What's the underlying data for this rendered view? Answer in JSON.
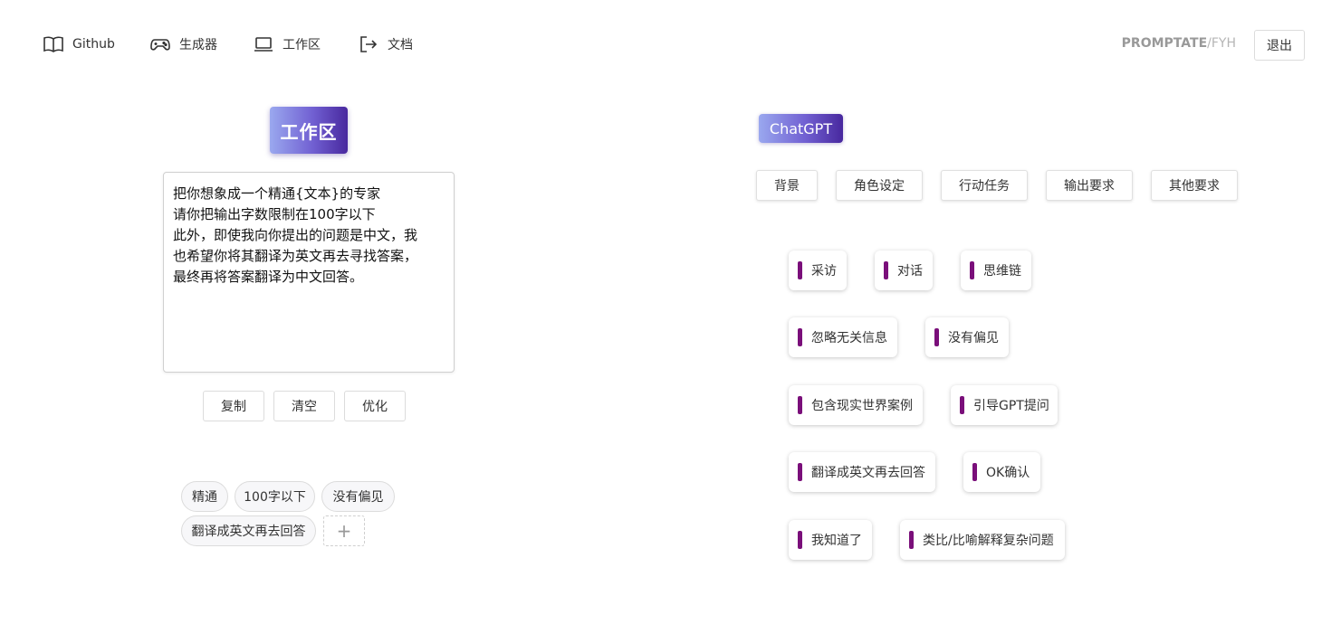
{
  "nav": {
    "items": [
      {
        "label": "Github",
        "icon": "book-open-icon"
      },
      {
        "label": "生成器",
        "icon": "gamepad-icon"
      },
      {
        "label": "工作区",
        "icon": "laptop-icon"
      },
      {
        "label": "文档",
        "icon": "sign-out-icon"
      }
    ],
    "brand_strong": "PROMPTATE",
    "brand_light": "/FYH",
    "logout_label": "退出"
  },
  "workspace": {
    "title": "工作区",
    "editor_lines": [
      "把你想象成一个精通{文本}的专家",
      "请你把输出字数限制在100字以下",
      "此外，即使我向你提出的问题是中文，我",
      "也希望你将其翻译为英文再去寻找答案，",
      "最终再将答案翻译为中文回答。"
    ],
    "buttons": {
      "copy": "复制",
      "clear": "清空",
      "optimize": "优化"
    },
    "tags": [
      "精通",
      "100字以下",
      "没有偏见",
      "翻译成英文再去回答"
    ],
    "add_tag": "+"
  },
  "chatgpt": {
    "title": "ChatGPT",
    "categories": [
      "背景",
      "角色设定",
      "行动任务",
      "输出要求",
      "其他要求"
    ],
    "chips": [
      "采访",
      "对话",
      "思维链",
      "忽略无关信息",
      "没有偏见",
      "包含现实世界案例",
      "引导GPT提问",
      "翻译成英文再去回答",
      "OK确认",
      "我知道了",
      "类比/比喻解释复杂问题"
    ],
    "accent_color": "#7a0f7a"
  }
}
